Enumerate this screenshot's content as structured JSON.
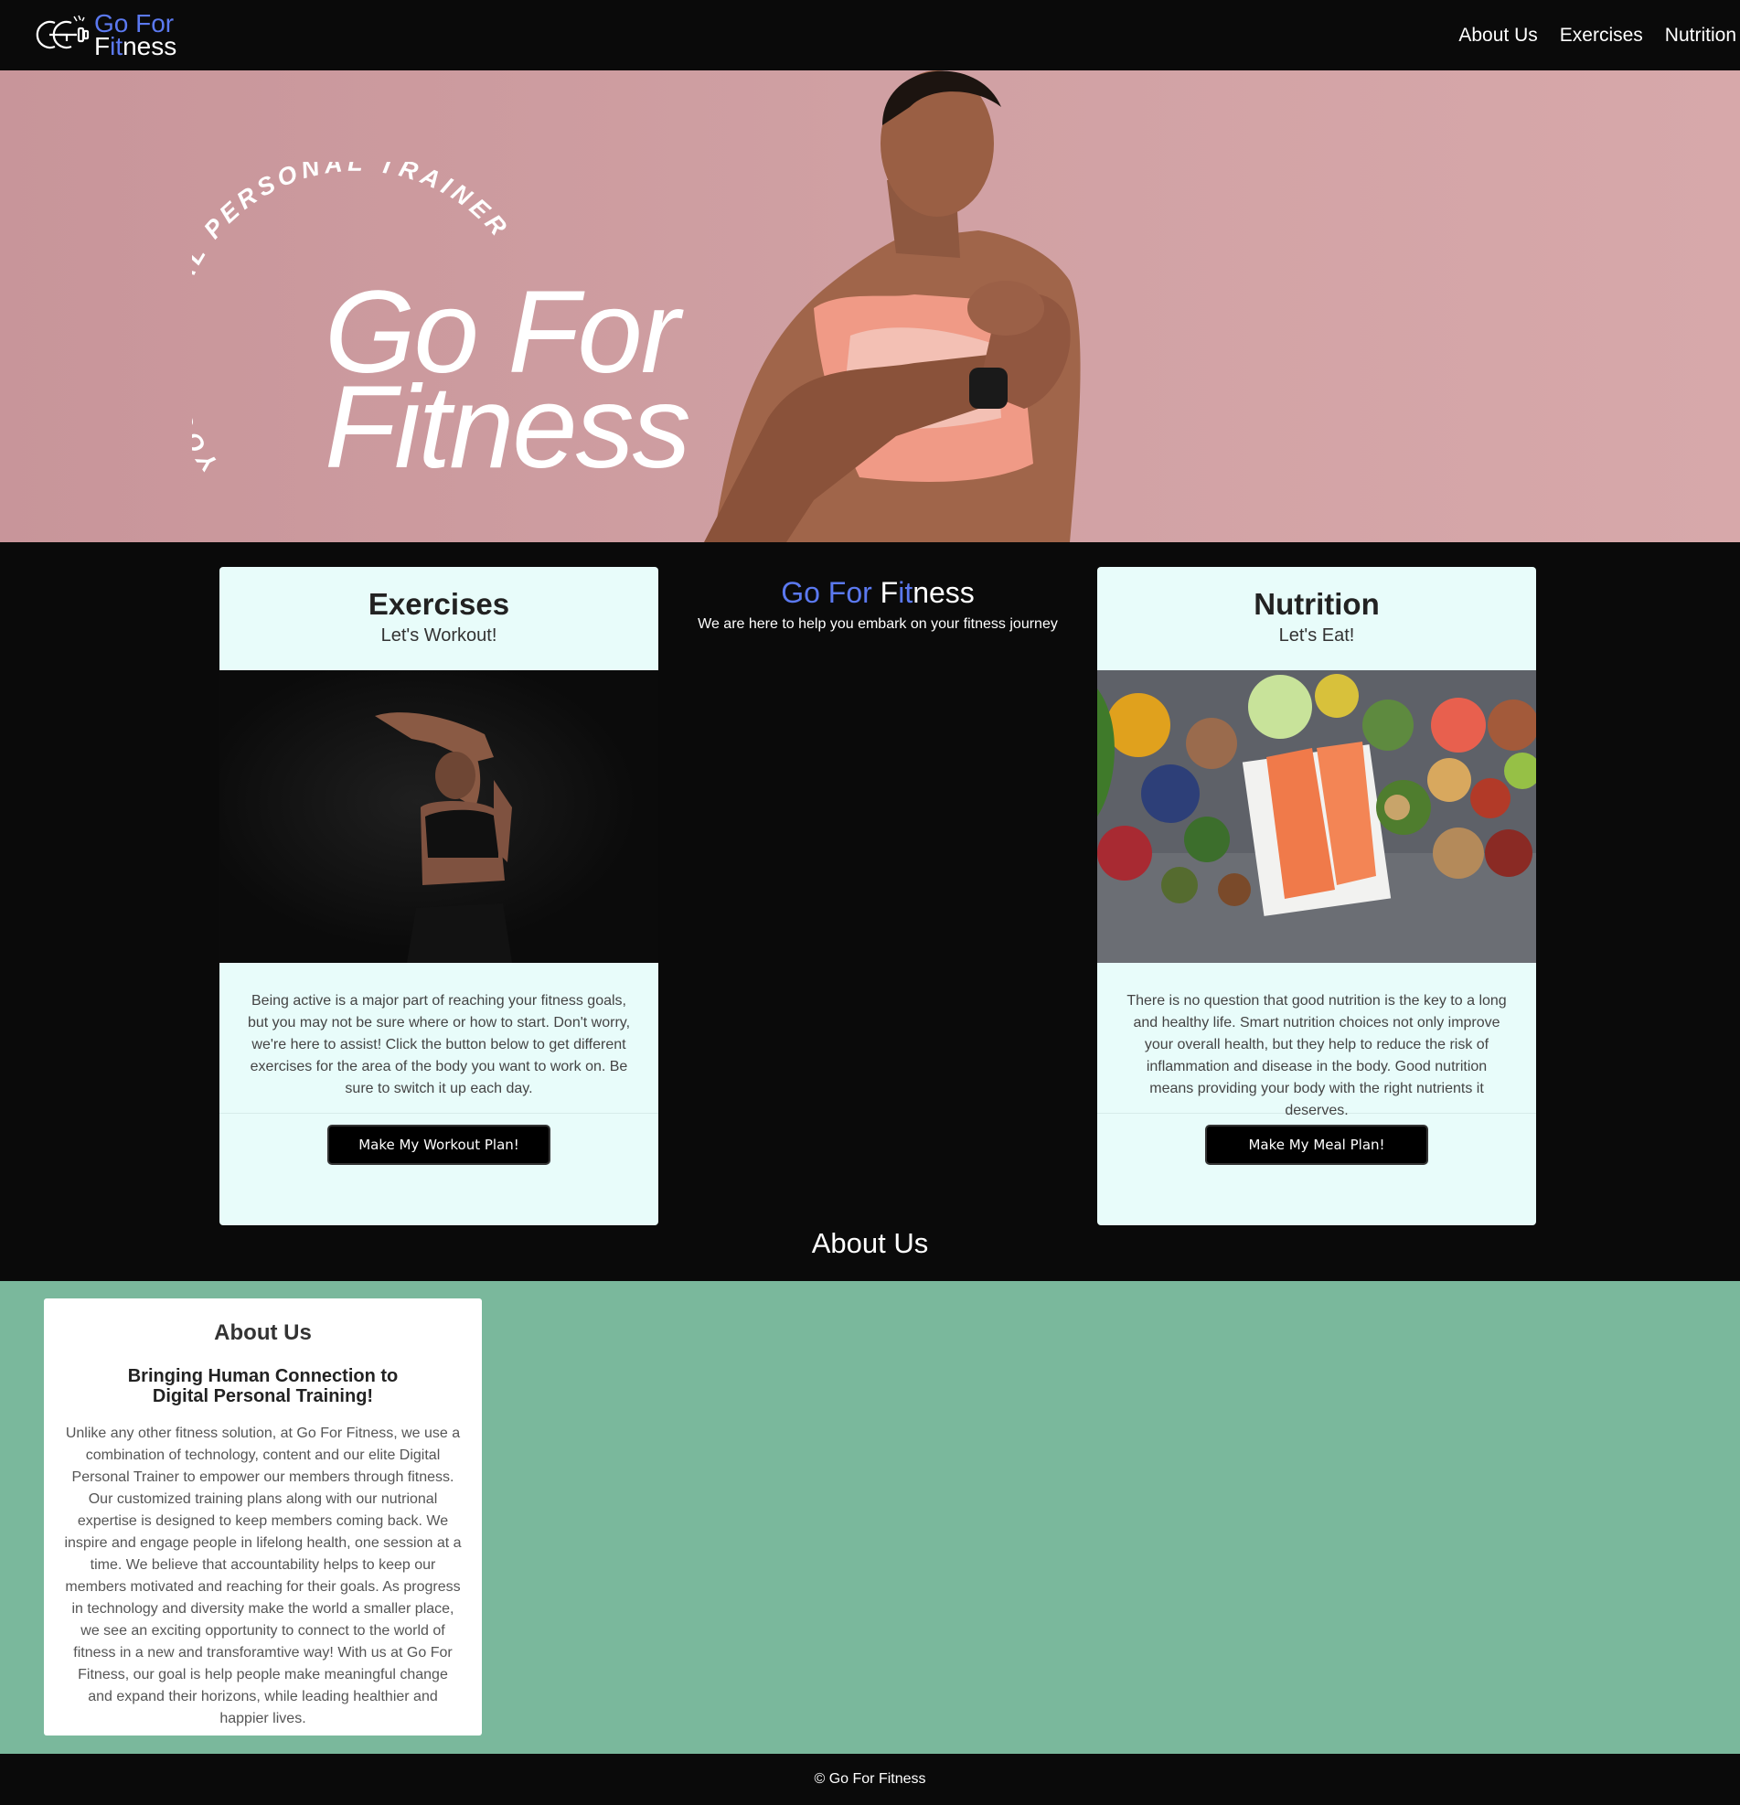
{
  "brand": {
    "logo_line1": "Go For",
    "logo_line2_a": "F",
    "logo_line2_b": "it",
    "logo_line2_c": "ness",
    "accent_color": "#5b79f0"
  },
  "nav": {
    "items": [
      {
        "label": "About Us"
      },
      {
        "label": "Exercises"
      },
      {
        "label": "Nutrition"
      }
    ]
  },
  "hero": {
    "arc_text": "YOUR DIGITAL PERSONAL TRAINER",
    "title_line1": "Go For",
    "title_line2": "Fitness"
  },
  "center": {
    "title_a": "Go For ",
    "title_b": "F",
    "title_c": "it",
    "title_d": "ness",
    "tagline": "We are here to help you embark on your fitness journey"
  },
  "exercises_card": {
    "title": "Exercises",
    "subtitle": "Let's Workout!",
    "text": "Being active is a major part of reaching your fitness goals, but you may not be sure where or how to start. Don't worry, we're here to assist! Click the button below to get different exercises for the area of the body you want to work on. Be sure to switch it up each day.",
    "button": "Make My Workout Plan!"
  },
  "nutrition_card": {
    "title": "Nutrition",
    "subtitle": "Let's Eat!",
    "text": "There is no question that good nutrition is the key to a long and healthy life. Smart nutrition choices not only improve your overall health, but they help to reduce the risk of inflammation and disease in the body. Good nutrition means providing your body with the right nutrients it deserves.",
    "button": "Make My Meal Plan!"
  },
  "about": {
    "section_heading": "About Us",
    "card_title": "About Us",
    "card_subtitle": "Bringing Human Connection to Digital Personal Training!",
    "card_text": "Unlike any other fitness solution, at Go For Fitness, we use a combination of technology, content and our elite Digital Personal Trainer to empower our members through fitness. Our customized training plans along with our nutrional expertise is designed to keep members coming back. We inspire and engage people in lifelong health, one session at a time. We believe that accountability helps to keep our members motivated and reaching for their goals. As progress in technology and diversity make the world a smaller place, we see an exciting opportunity to connect to the world of fitness in a new and transforamtive way! With us at Go For Fitness, our goal is help people make meaningful change and expand their horizons, while leading healthier and happier lives."
  },
  "footer": {
    "text": "© Go For Fitness"
  }
}
